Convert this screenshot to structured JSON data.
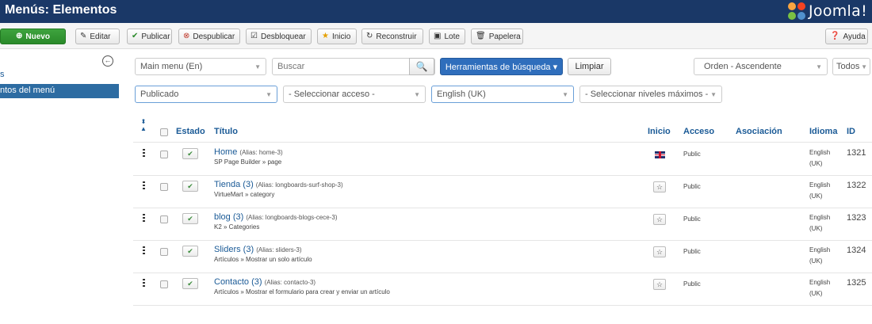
{
  "header": {
    "title": "Menús: Elementos",
    "logo_text": "Joomla!"
  },
  "toolbar": {
    "new": "Nuevo",
    "edit": "Editar",
    "publish": "Publicar",
    "unpublish": "Despublicar",
    "unlock": "Desbloquear",
    "home": "Inicio",
    "rebuild": "Reconstruir",
    "batch": "Lote",
    "trash": "Papelera",
    "help": "Ayuda"
  },
  "sidebar": {
    "item1": "s",
    "item2": "ntos del menú"
  },
  "filters": {
    "menu": "Main menu (En)",
    "search_placeholder": "Buscar",
    "search_tools": "Herramientas de búsqueda ▾",
    "clear": "Limpiar",
    "order": "Orden - Ascendente",
    "limit": "Todos",
    "state": "Publicado",
    "access": "- Seleccionar acceso -",
    "language": "English (UK)",
    "levels": "- Seleccionar niveles máximos -"
  },
  "table": {
    "columns": {
      "status": "Estado",
      "title": "Título",
      "home": "Inicio",
      "access": "Acceso",
      "association": "Asociación",
      "language": "Idioma",
      "id": "ID"
    },
    "rows": [
      {
        "title": "Home",
        "alias": "(Alias: home-3)",
        "type": "SP Page Builder » page",
        "home": "flag",
        "access": "Public",
        "lang1": "English",
        "lang2": "(UK)",
        "id": "1321"
      },
      {
        "title": "Tienda (3)",
        "alias": "(Alias: longboards-surf-shop-3)",
        "type": "VirtueMart » category",
        "home": "star",
        "access": "Public",
        "lang1": "English",
        "lang2": "(UK)",
        "id": "1322"
      },
      {
        "title": "blog (3)",
        "alias": "(Alias: longboards-blogs-cece-3)",
        "type": "K2 » Categories",
        "home": "star",
        "access": "Public",
        "lang1": "English",
        "lang2": "(UK)",
        "id": "1323"
      },
      {
        "title": "Sliders (3)",
        "alias": "(Alias: sliders-3)",
        "type": "Artículos » Mostrar un solo artículo",
        "home": "star",
        "access": "Public",
        "lang1": "English",
        "lang2": "(UK)",
        "id": "1324"
      },
      {
        "title": "Contacto (3)",
        "alias": "(Alias: contacto-3)",
        "type": "Artículos » Mostrar el formulario para crear y enviar un artículo",
        "home": "star",
        "access": "Public",
        "lang1": "English",
        "lang2": "(UK)",
        "id": "1325"
      }
    ]
  },
  "colors": {
    "header": "#1a3867",
    "link": "#1a5a96",
    "primary": "#2f6ebc",
    "success": "#2a8a2a"
  }
}
